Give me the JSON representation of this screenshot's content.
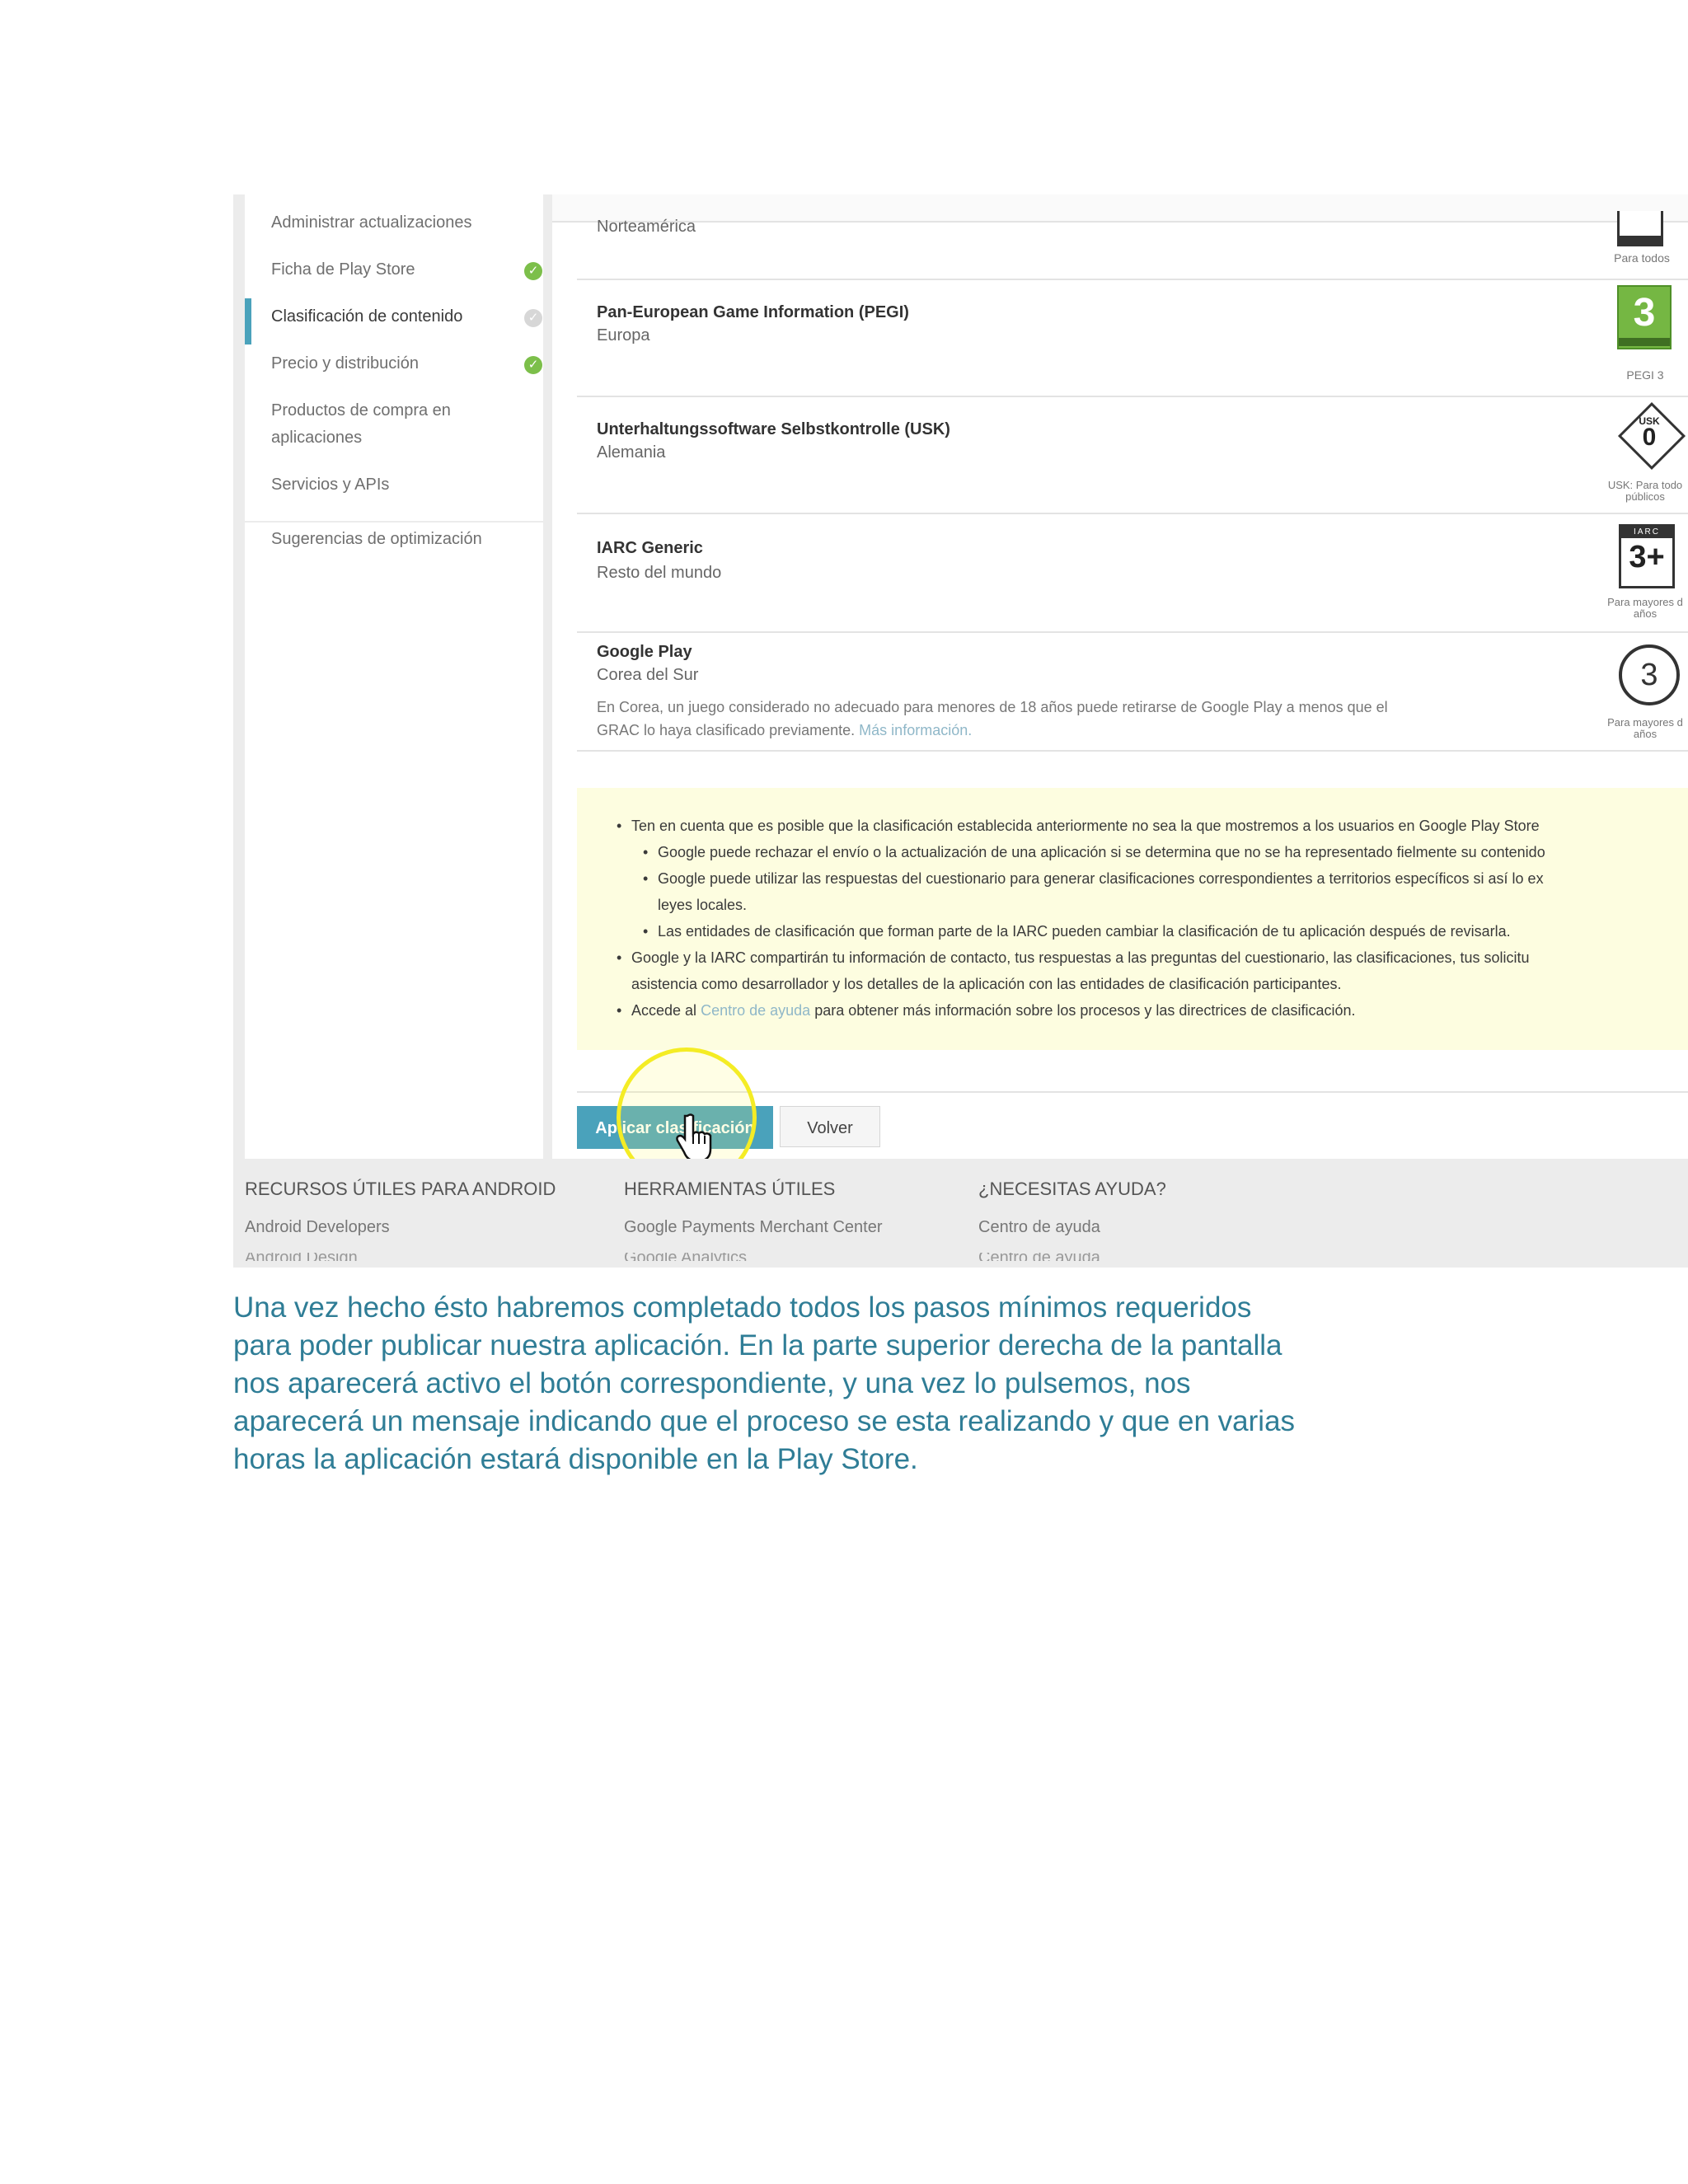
{
  "sidebar": {
    "items": [
      {
        "label": "Administrar actualizaciones",
        "status": "none"
      },
      {
        "label": "Ficha de Play Store",
        "status": "complete"
      },
      {
        "label": "Clasificación de contenido",
        "status": "pending"
      },
      {
        "label": "Precio y distribución",
        "status": "complete"
      },
      {
        "label": "Productos de compra en",
        "label2": "aplicaciones",
        "status": "none"
      },
      {
        "label": "Servicios y APIs",
        "status": "none"
      }
    ],
    "optimization": "Sugerencias de optimización"
  },
  "ratings": [
    {
      "title": "",
      "region": "Norteamérica",
      "caption": "Para todos",
      "badge": "esrb-icon"
    },
    {
      "title": "Pan-European Game Information (PEGI)",
      "region": "Europa",
      "caption": "PEGI 3",
      "badge_value": "3"
    },
    {
      "title": "Unterhaltungssoftware Selbstkontrolle (USK)",
      "region": "Alemania",
      "caption": "USK: Para todo",
      "caption2": "públicos",
      "badge_value": "0",
      "badge_label": "USK"
    },
    {
      "title": "IARC Generic",
      "region": "Resto del mundo",
      "caption": "Para mayores d",
      "caption2": "años",
      "badge_value": "3+",
      "badge_label": "IARC"
    },
    {
      "title": "Google Play",
      "region": "Corea del Sur",
      "note": "En Corea, un juego considerado no adecuado para menores de 18 años puede retirarse de Google Play a menos que el",
      "note2": "GRAC lo haya clasificado previamente.",
      "note_link": "Más información.",
      "caption": "Para mayores d",
      "caption2": "años",
      "badge_value": "3"
    }
  ],
  "notice": {
    "l1": "Ten en cuenta que es posible que la clasificación establecida anteriormente no sea la que mostremos a los usuarios en Google Play Store",
    "l2": "Google puede rechazar el envío o la actualización de una aplicación si se determina que no se ha representado fielmente su contenido",
    "l3": "Google puede utilizar las respuestas del cuestionario para generar clasificaciones correspondientes a territorios específicos si así lo ex",
    "l3b": "leyes locales.",
    "l4": "Las entidades de clasificación que forman parte de la IARC pueden cambiar la clasificación de tu aplicación después de revisarla.",
    "l5": "Google y la IARC compartirán tu información de contacto, tus respuestas a las preguntas del cuestionario, las clasificaciones, tus solicitu",
    "l5b": "asistencia como desarrollador y los detalles de la aplicación con las entidades de clasificación participantes.",
    "l6a": "Accede al",
    "l6link": "Centro de ayuda",
    "l6b": "para obtener más información sobre los procesos y las directrices de clasificación."
  },
  "buttons": {
    "apply": "Aplicar clasificación",
    "back": "Volver"
  },
  "footer": {
    "cols": [
      {
        "head": "RECURSOS ÚTILES PARA ANDROID",
        "link": "Android Developers",
        "cut": "Android Design"
      },
      {
        "head": "HERRAMIENTAS ÚTILES",
        "link": "Google Payments Merchant Center",
        "cut": "Google Analytics"
      },
      {
        "head": "¿NECESITAS AYUDA?",
        "link": "Centro de ayuda",
        "cut": "Centro de ayuda"
      }
    ]
  },
  "caption": {
    "l1": "Una vez hecho ésto habremos completado todos los pasos mínimos requeridos",
    "l2": "para poder publicar nuestra aplicación. En la parte superior derecha de la pantalla",
    "l3": "nos aparecerá activo el botón correspondiente, y una vez lo pulsemos, nos",
    "l4": "aparecerá un mensaje indicando que el proceso se esta realizando y que en varias",
    "l5": "horas la aplicación estará disponible en la Play Store."
  },
  "colors": {
    "accent": "#4aa2bb",
    "complete": "#7cbf4a",
    "notice_bg": "#fdfde0",
    "caption_text": "#2f7d96",
    "highlight": "#f4ec25"
  }
}
